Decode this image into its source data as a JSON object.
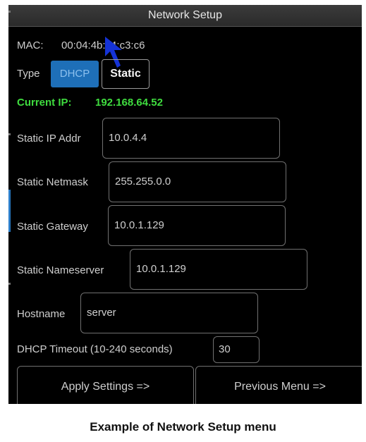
{
  "window": {
    "title": "Network Setup"
  },
  "mac": {
    "label": "MAC:",
    "value": "00:04:4b:c4:c3:c6"
  },
  "type": {
    "label": "Type",
    "options": [
      "DHCP",
      "Static"
    ],
    "selected": "DHCP"
  },
  "current_ip": {
    "label": "Current IP:",
    "value": "192.168.64.52",
    "color": "#3fdc3f"
  },
  "fields": {
    "static_ip": {
      "label": "Static IP Addr",
      "value": "10.0.4.4"
    },
    "netmask": {
      "label": "Static Netmask",
      "value": "255.255.0.0"
    },
    "gateway": {
      "label": "Static Gateway",
      "value": "10.0.1.129"
    },
    "nameserver": {
      "label": "Static Nameserver",
      "value": "10.0.1.129"
    },
    "hostname": {
      "label": "Hostname",
      "value": "server"
    },
    "dhcp_timeout": {
      "label": "DHCP Timeout (10-240 seconds)",
      "value": "30"
    }
  },
  "buttons": {
    "apply": "Apply Settings =>",
    "previous": "Previous Menu =>"
  },
  "caption": "Example of Network Setup menu",
  "accent": "#1e6fb8"
}
